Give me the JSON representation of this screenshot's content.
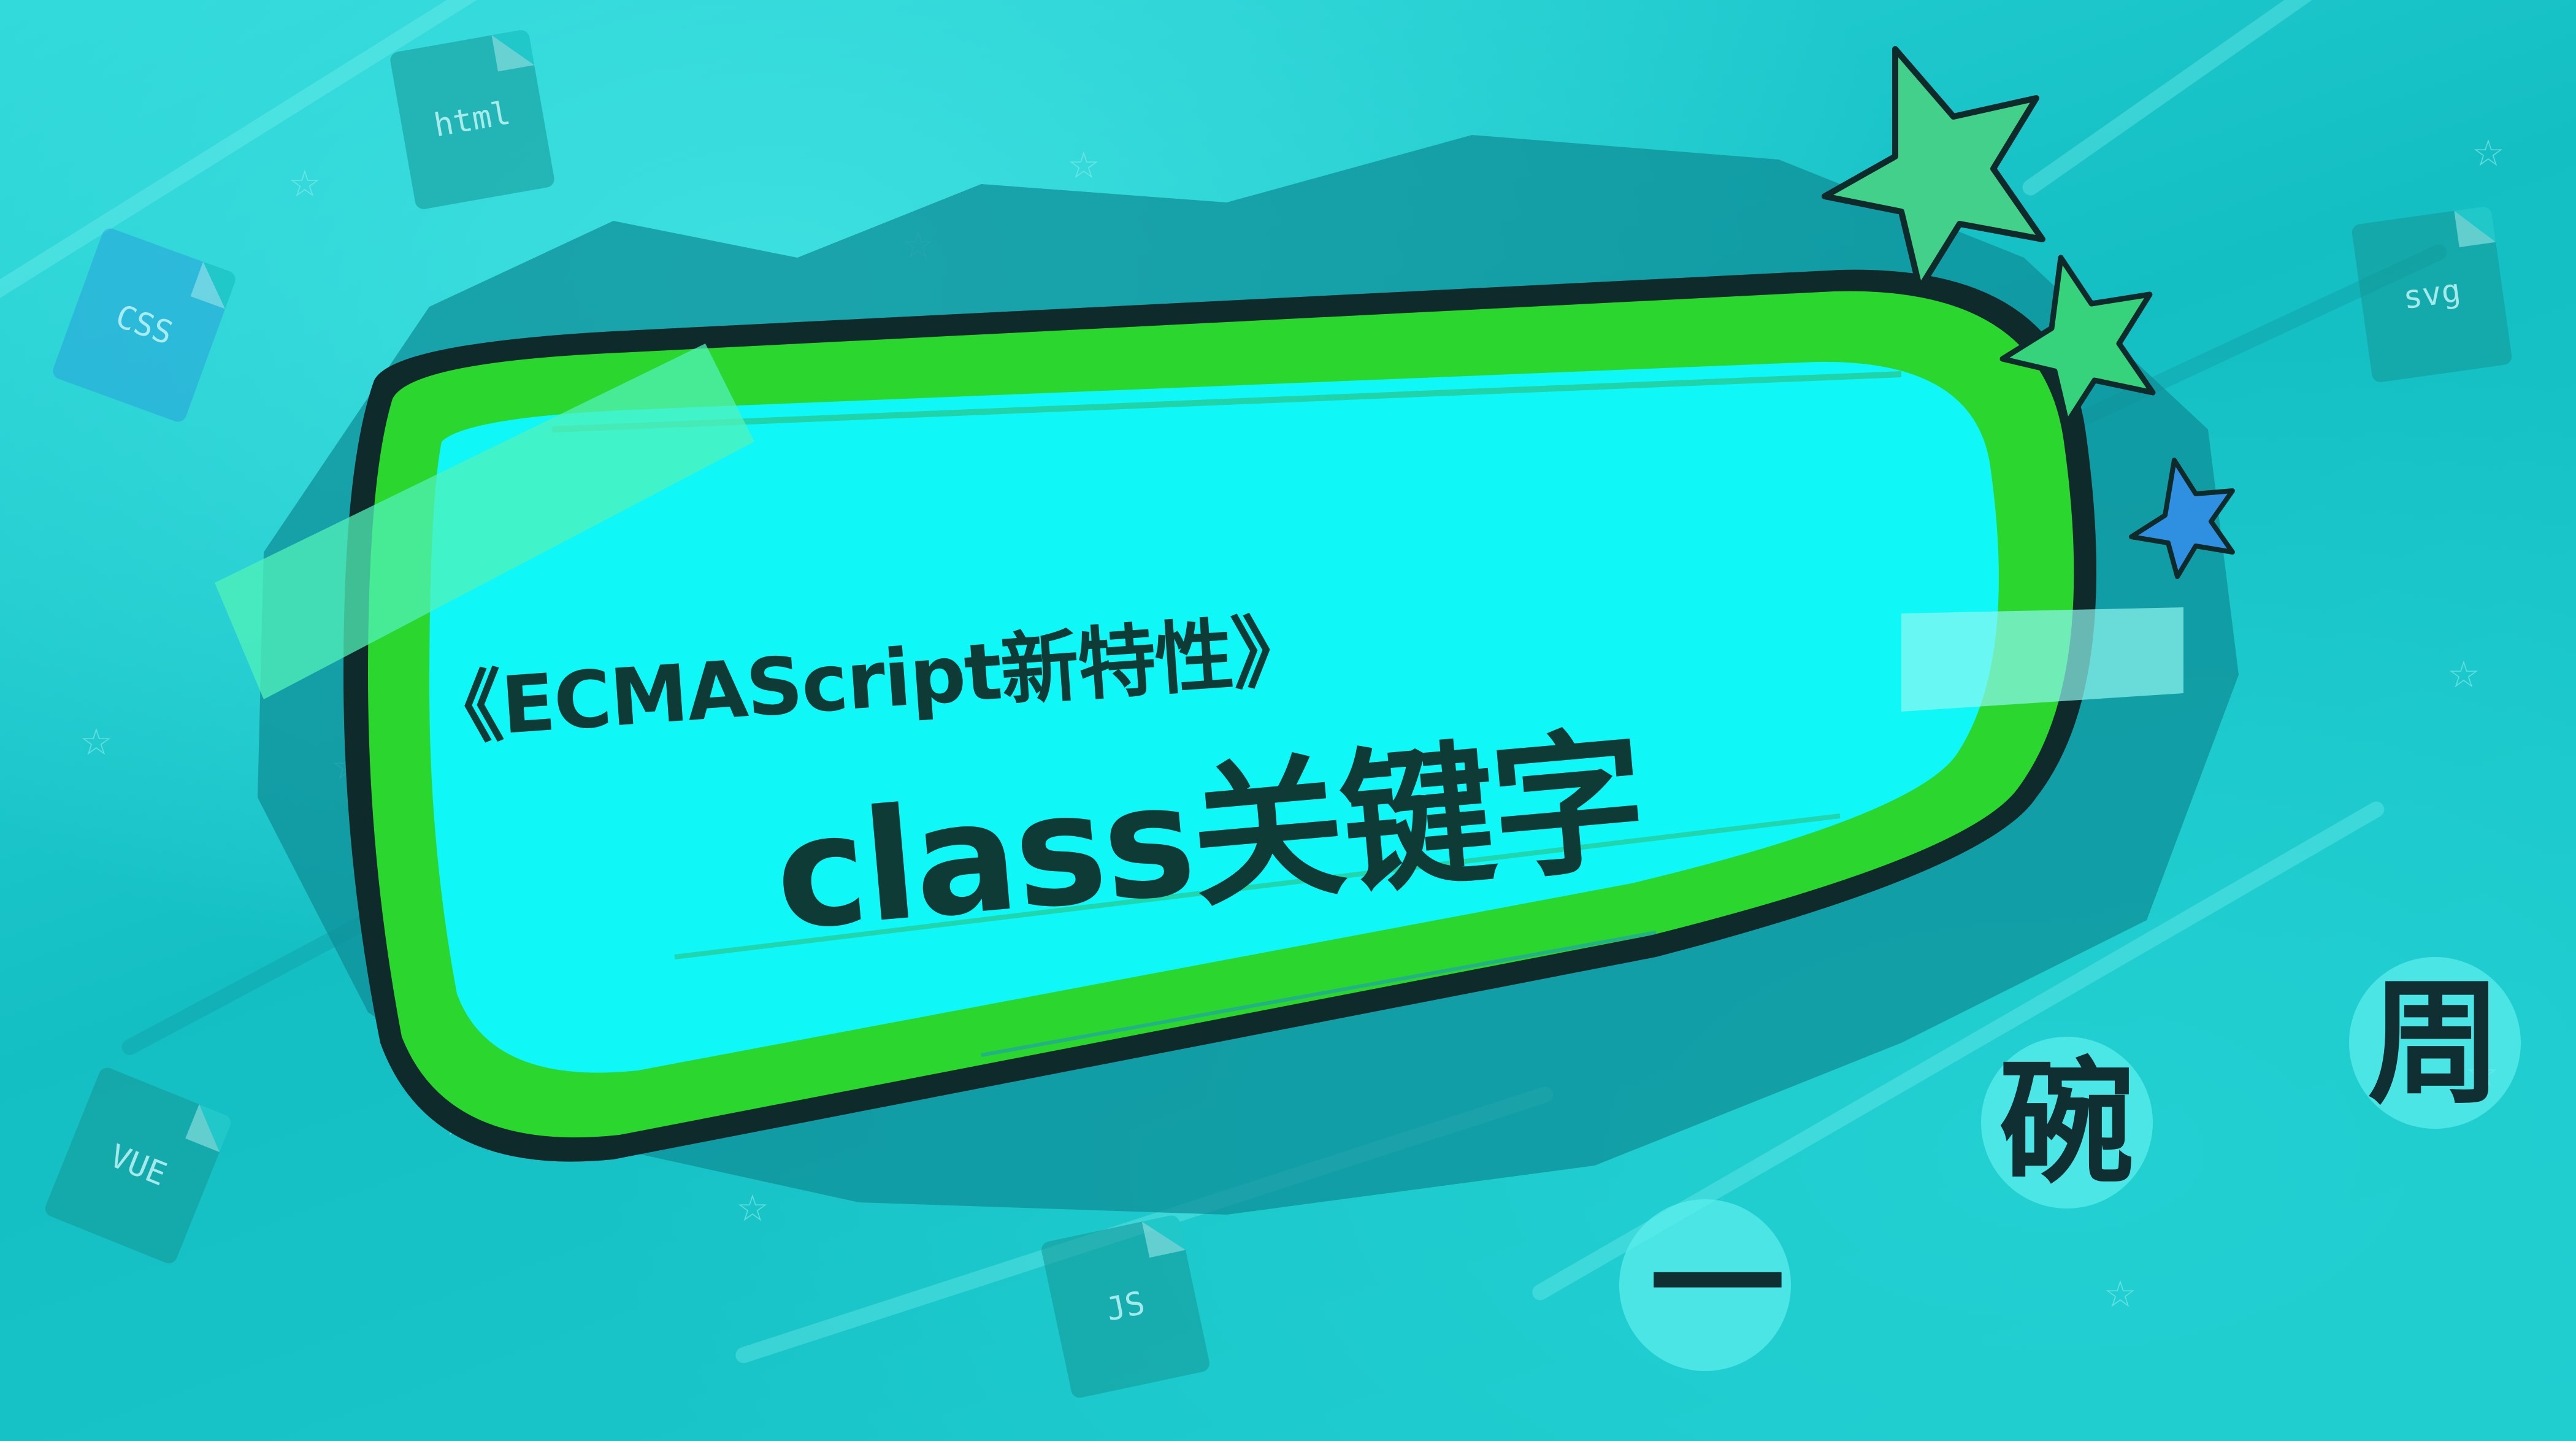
{
  "banner": {
    "subtitle": "《ECMAScript新特性》",
    "title": "class关键字"
  },
  "file_icons": [
    "html",
    "CSS",
    "svg",
    "VUE",
    "JS"
  ],
  "signature": [
    "一",
    "碗",
    "周"
  ],
  "colors": {
    "background": "#1cc6c9",
    "banner_fill": "#0ff7f7",
    "banner_rim": "#2bd62f",
    "outline": "#0e2a2a",
    "text": "#0e3b36",
    "star_blue": "#2f8fe0",
    "star_green": "#43d08a"
  }
}
